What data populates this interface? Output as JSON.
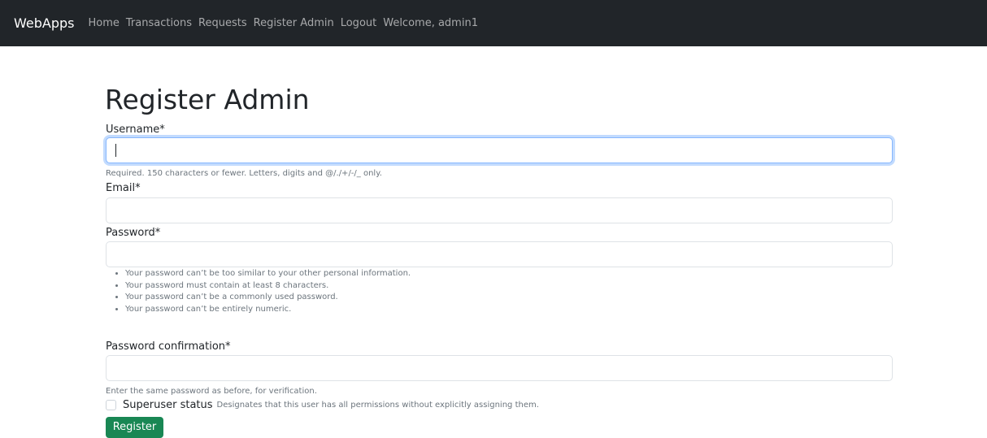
{
  "navbar": {
    "brand": "WebApps",
    "links": [
      "Home",
      "Transactions",
      "Requests",
      "Register Admin",
      "Logout"
    ],
    "welcome": "Welcome, admin1"
  },
  "page": {
    "title": "Register Admin"
  },
  "form": {
    "username": {
      "label": "Username*",
      "value": "",
      "help": "Required. 150 characters or fewer. Letters, digits and @/./+/-/_ only."
    },
    "email": {
      "label": "Email*",
      "value": ""
    },
    "password": {
      "label": "Password*",
      "value": "",
      "rules": [
        "Your password can’t be too similar to your other personal information.",
        "Your password must contain at least 8 characters.",
        "Your password can’t be a commonly used password.",
        "Your password can’t be entirely numeric."
      ]
    },
    "password_confirmation": {
      "label": "Password confirmation*",
      "value": "",
      "help": "Enter the same password as before, for verification."
    },
    "superuser": {
      "label": "Superuser status",
      "help": "Designates that this user has all permissions without explicitly assigning them.",
      "checked": false
    },
    "submit_label": "Register"
  },
  "colors": {
    "navbar_bg": "#212529",
    "primary_button": "#198754",
    "focus_border": "#86b7fe"
  }
}
